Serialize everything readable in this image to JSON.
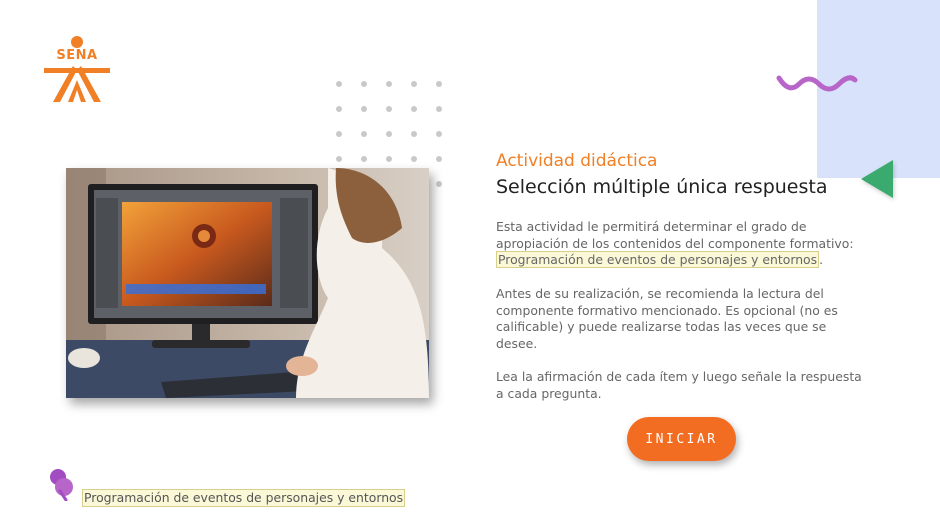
{
  "logo": {
    "text": "SENA"
  },
  "activity": {
    "label": "Actividad didáctica",
    "title": "Selección múltiple única respuesta"
  },
  "description": {
    "p1_intro": "Esta actividad le permitirá determinar el grado de apropiación de los contenidos del componente formativo: ",
    "p1_highlight": "Programación de eventos de personajes y entornos",
    "p1_end": ".",
    "p2": "Antes de su realización, se recomienda la lectura del componente formativo mencionado.  Es opcional (no es calificable) y puede realizarse todas las veces que se desee.",
    "p3": "Lea la afirmación de cada ítem y luego señale la respuesta a cada pregunta."
  },
  "start_button": {
    "label": "INICIAR"
  },
  "footer": {
    "component_label": "Programación de eventos de personajes y entornos"
  },
  "colors": {
    "accent": "#f26d21",
    "sena_orange": "#f07f26",
    "wave_purple": "#b765c9",
    "triangle_green": "#3aaa6e",
    "panel_blue": "#d9e2fb"
  },
  "icons": {
    "logo": "sena-logo-icon",
    "wave": "wave-decoration-icon",
    "triangle": "triangle-decoration-icon",
    "pin": "pin-icon"
  }
}
